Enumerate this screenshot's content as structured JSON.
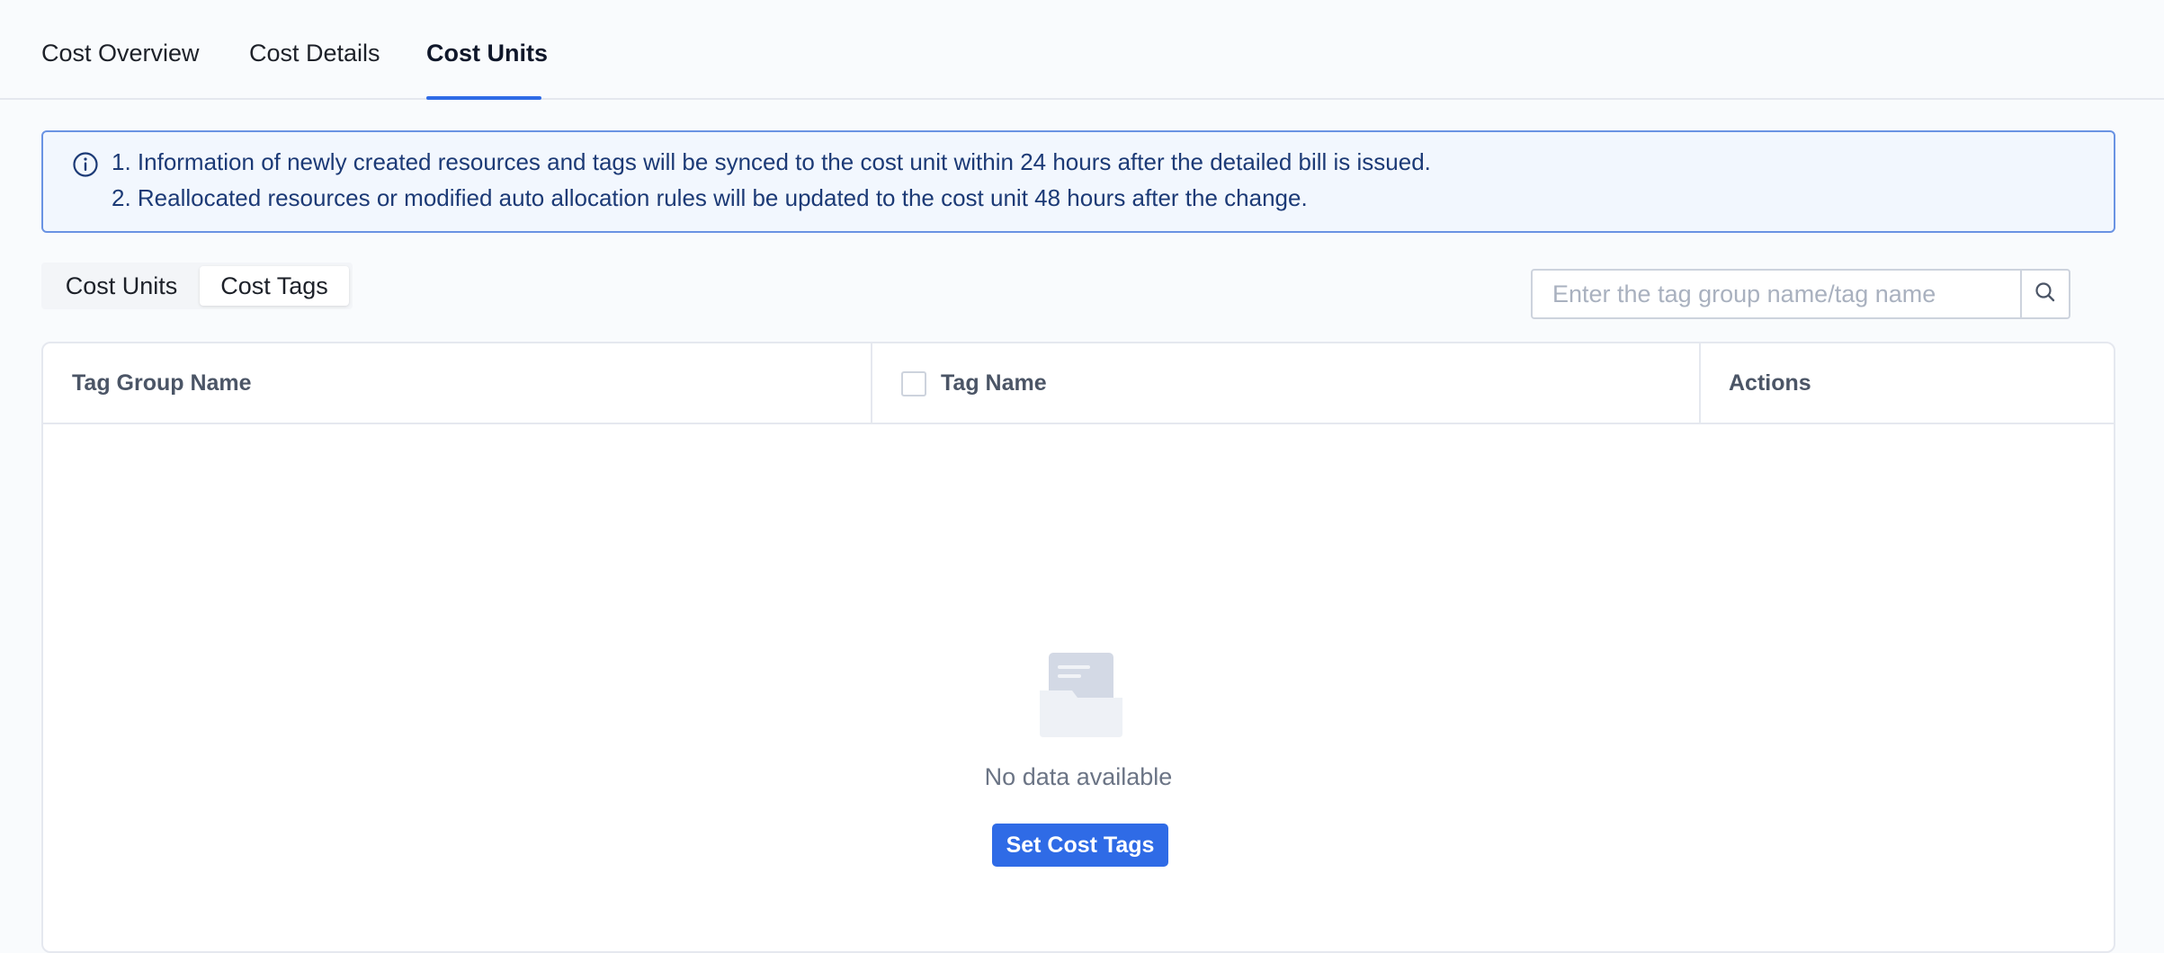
{
  "tabs": [
    {
      "label": "Cost Overview",
      "active": false
    },
    {
      "label": "Cost Details",
      "active": false
    },
    {
      "label": "Cost Units",
      "active": true
    }
  ],
  "notice": {
    "icon": "info-circle-icon",
    "lines": [
      "1. Information of newly created resources and tags will be synced to the cost unit within 24 hours after the detailed bill is issued.",
      "2. Reallocated resources or modified auto allocation rules will be updated to the cost unit 48 hours after the change."
    ]
  },
  "segmented": {
    "options": [
      {
        "label": "Cost Units",
        "active": false
      },
      {
        "label": "Cost Tags",
        "active": true
      }
    ]
  },
  "search": {
    "placeholder": "Enter the tag group name/tag name",
    "value": "",
    "icon": "search-icon"
  },
  "table": {
    "columns": [
      "Tag Group Name",
      "Tag Name",
      "Actions"
    ],
    "rows": [],
    "empty": {
      "icon": "empty-folder-icon",
      "message": "No data available",
      "action_label": "Set Cost Tags"
    }
  },
  "colors": {
    "accent": "#2f6be6",
    "notice_bg": "#f2f7fe",
    "notice_border": "#6a93e3",
    "notice_text": "#1c3a76",
    "page_bg": "#f9fbfd"
  }
}
